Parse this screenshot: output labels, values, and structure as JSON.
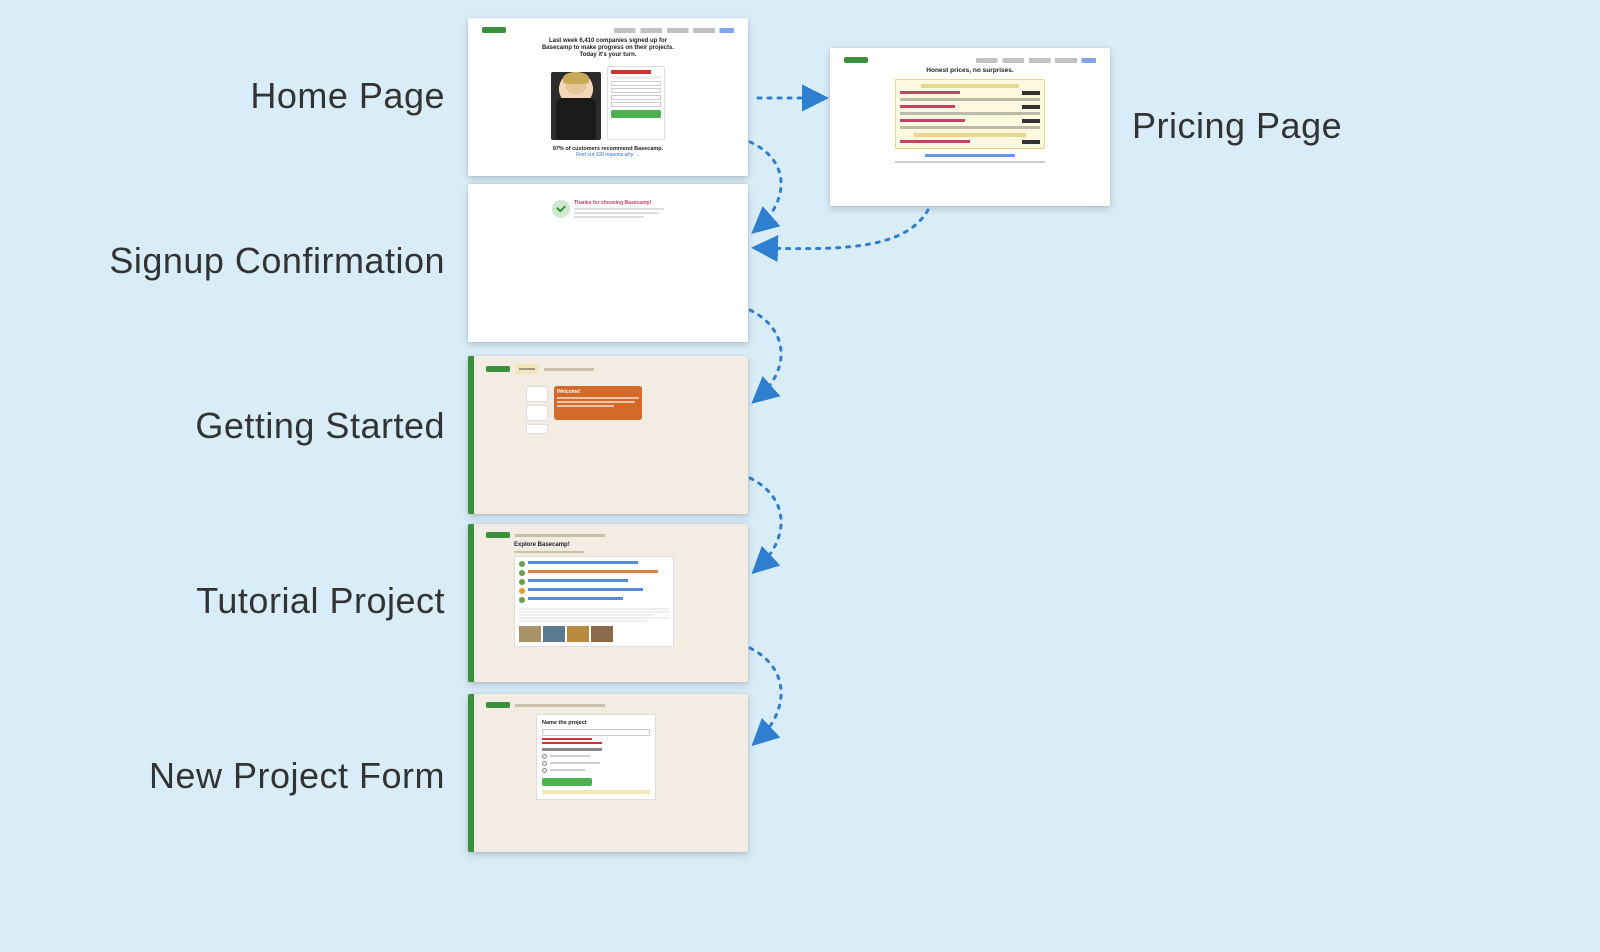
{
  "labels": {
    "home": "Home Page",
    "pricing": "Pricing Page",
    "signup": "Signup Confirmation",
    "getting_started": "Getting Started",
    "tutorial": "Tutorial Project",
    "new_project": "New Project Form"
  },
  "home_thumb": {
    "headline1": "Last week 6,410 companies signed up for",
    "headline2": "Basecamp to make progress on their projects.",
    "headline3": "Today it's your turn.",
    "sub": "97% of customers recommend Basecamp.",
    "link": "Find out 100 reasons why →"
  },
  "pricing_thumb": {
    "title": "Honest prices, no surprises."
  },
  "signup_thumb": {
    "thanks": "Thanks for choosing Basecamp!"
  },
  "getting_started_thumb": {
    "welcome": "Welcome!"
  },
  "tutorial_thumb": {
    "title": "Explore Basecamp!"
  },
  "new_project_thumb": {
    "title": "Name the project"
  },
  "colors": {
    "arrow": "#2f7fd0"
  }
}
